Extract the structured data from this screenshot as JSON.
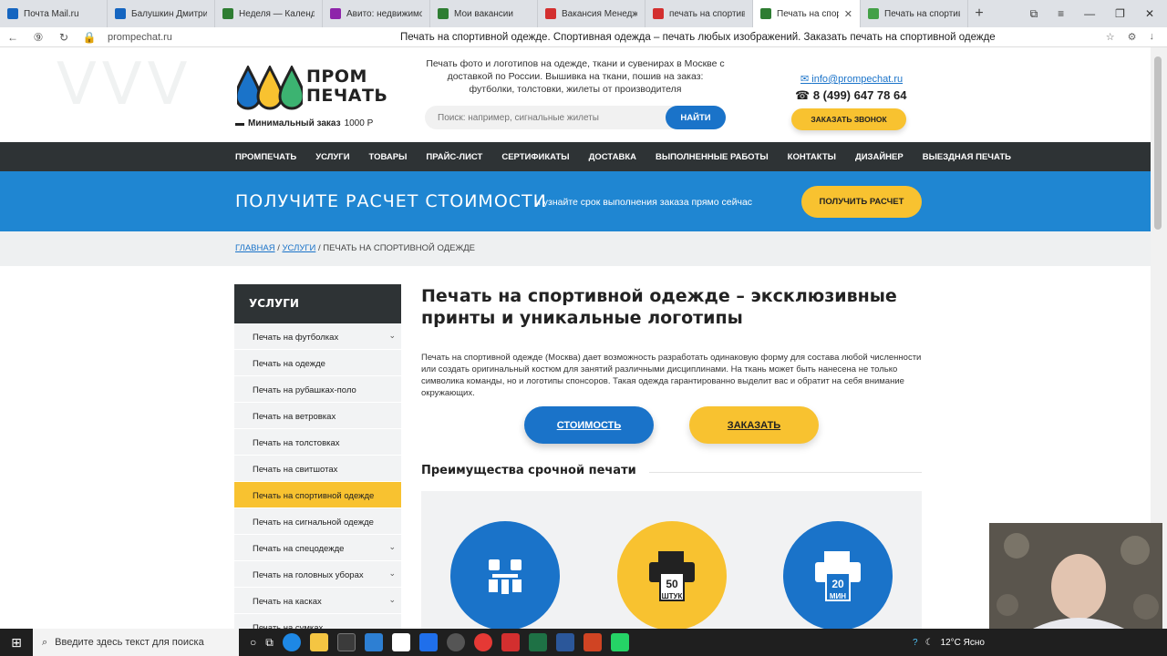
{
  "browser": {
    "tabs": [
      {
        "label": "Почта Mail.ru",
        "color": "#1565c0"
      },
      {
        "label": "Балушкин Дмитрий.с",
        "color": "#1565c0"
      },
      {
        "label": "Неделя — Календарь",
        "color": "#2e7d32"
      },
      {
        "label": "Авито: недвижимость",
        "color": "#8e24aa"
      },
      {
        "label": "Мои вакансии",
        "color": "#2e7d32"
      },
      {
        "label": "Вакансия Менеджер",
        "color": "#d32f2f"
      },
      {
        "label": "печать на спортивно",
        "color": "#d32f2f"
      },
      {
        "label": "Печать на спортивн",
        "color": "#2e7d32",
        "active": true
      },
      {
        "label": "Печать на спортивно",
        "color": "#43a047"
      }
    ],
    "new_tab": "+",
    "window_controls": [
      "⧉",
      "≡",
      "—",
      "❐",
      "✕"
    ],
    "url": "prompechat.ru",
    "page_title": "Печать на спортивной одежде. Спортивная одежда – печать любых изображений. Заказать печать на спортивной одежде",
    "nav_icons": [
      "←",
      "⑨",
      "↻",
      "🔒"
    ]
  },
  "header": {
    "logo_line1": "ПРОМ",
    "logo_line2": "ПЕЧАТЬ",
    "min_order_label": "Минимальный заказ",
    "min_order_value": "1000 Р",
    "tagline": "Печать фото и логотипов на одежде, ткани и сувенирах в Москве с доставкой по России. Вышивка на ткани, пошив на заказ: футболки, толстовки, жилеты от производителя",
    "search_placeholder": "Поиск: например, сигнальные жилеты",
    "search_button": "НАЙТИ",
    "email": "info@prompechat.ru",
    "phone": "8 (499) 647 78 64",
    "callback_button": "ЗАКАЗАТЬ ЗВОНОК",
    "drop_colors": [
      "#1a73c9",
      "#f8c230",
      "#3cb371"
    ]
  },
  "nav": {
    "items": [
      "ПРОМПЕЧАТЬ",
      "УСЛУГИ",
      "ТОВАРЫ",
      "ПРАЙС-ЛИСТ",
      "СЕРТИФИКАТЫ",
      "ДОСТАВКА",
      "ВЫПОЛНЕННЫЕ РАБОТЫ",
      "КОНТАКТЫ",
      "ДИЗАЙНЕР",
      "ВЫЕЗДНАЯ ПЕЧАТЬ"
    ]
  },
  "banner": {
    "title": "ПОЛУЧИТЕ РАСЧЕТ СТОИМОСТИ",
    "subtitle": "и узнайте срок выполнения заказа прямо сейчас",
    "button": "ПОЛУЧИТЬ РАСЧЕТ"
  },
  "breadcrumb": {
    "home": "ГЛАВНАЯ",
    "services": "УСЛУГИ",
    "current": "ПЕЧАТЬ НА СПОРТИВНОЙ ОДЕЖДЕ"
  },
  "sidebar": {
    "title": "УСЛУГИ",
    "items": [
      {
        "label": "Печать на футболках",
        "chevron": true
      },
      {
        "label": "Печать на одежде",
        "chevron": false
      },
      {
        "label": "Печать на рубашках-поло",
        "chevron": false
      },
      {
        "label": "Печать на ветровках",
        "chevron": false
      },
      {
        "label": "Печать на толстовках",
        "chevron": false
      },
      {
        "label": "Печать на свитшотах",
        "chevron": false
      },
      {
        "label": "Печать на спортивной одежде",
        "chevron": false,
        "active": true
      },
      {
        "label": "Печать на сигнальной одежде",
        "chevron": false
      },
      {
        "label": "Печать на спецодежде",
        "chevron": true
      },
      {
        "label": "Печать на головных уборах",
        "chevron": true
      },
      {
        "label": "Печать на касках",
        "chevron": true
      },
      {
        "label": "Печать на сумках",
        "chevron": false
      }
    ]
  },
  "main": {
    "title": "Печать на спортивной одежде – эксклюзивные принты и уникальные логотипы",
    "intro": "Печать на спортивной одежде (Москва) дает возможность разработать одинаковую форму для состава любой численности или создать оригинальный костюм для занятий различными дисциплинами. На ткань может быть нанесена не только символика команды, но и логотипы спонсоров. Такая одежда гарантированно выделит вас и обратит на себя внимание окружающих.",
    "cost_button": "СТОИМОСТЬ",
    "order_button": "ЗАКАЗАТЬ",
    "advantages_title": "Преимущества срочной печати",
    "advantages": [
      {
        "icon": "meeting-icon",
        "color": "#1a73c9",
        "caption": ""
      },
      {
        "icon": "printer-50-icon",
        "color": "#f8c230",
        "number": "50",
        "unit": "ШТУК"
      },
      {
        "icon": "printer-20-icon",
        "color": "#1a73c9",
        "number": "20",
        "unit": "МИН"
      }
    ]
  },
  "taskbar": {
    "search_placeholder": "Введите здесь текст для поиска",
    "weather": "12°C  Ясно"
  }
}
